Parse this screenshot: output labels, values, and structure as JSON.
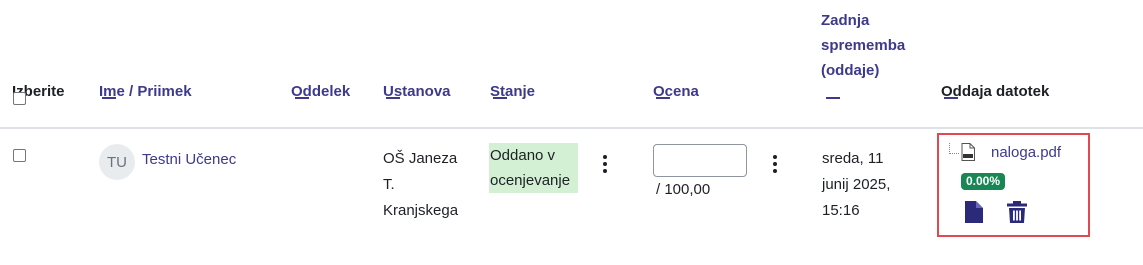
{
  "header": {
    "select_label": "Izberite",
    "name_label": "Ime / Priimek",
    "group_label": "Oddelek",
    "institution_label": "Ustanova",
    "status_label": "Stanje",
    "grade_label": "Ocena",
    "last_modified_line1": "Zadnja",
    "last_modified_line2": "sprememba",
    "last_modified_line3": "(oddaje)",
    "file_submissions_label": "Oddaja datotek"
  },
  "row": {
    "avatar_initials": "TU",
    "name": "Testni Učenec",
    "institution_line1": "OŠ Janeza",
    "institution_line2": "T.",
    "institution_line3": "Kranjskega",
    "status_line1": "Oddano v",
    "status_line2": "ocenjevanje",
    "grade_value": "",
    "grade_max": "/ 100,00",
    "modified_line1": "sreda, 11",
    "modified_line2": "junij 2025,",
    "modified_line3": "15:16",
    "file_name": "naloga.pdf",
    "file_percent": "0.00%"
  },
  "icons": {
    "pdf": "pdf-file-icon",
    "document": "document-icon",
    "trash": "trash-icon",
    "kebab": "kebab-menu-icon"
  },
  "colors": {
    "link": "#3d3a8c",
    "status_bg": "#d4f0d4",
    "badge": "#198754",
    "highlight_border": "#e34850"
  }
}
